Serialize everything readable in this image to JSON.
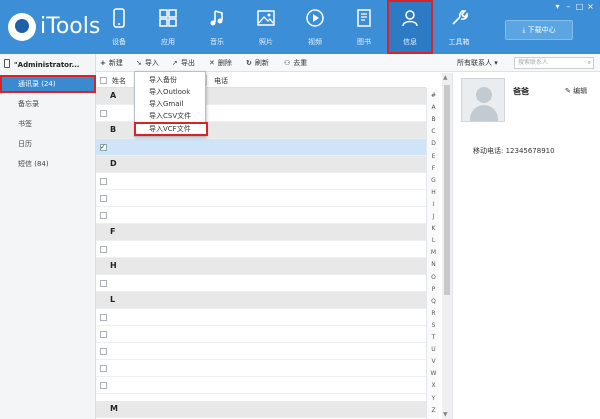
{
  "app": {
    "brand": "iTools"
  },
  "nav": [
    {
      "id": "device",
      "label": "设备",
      "icon": "phone-icon"
    },
    {
      "id": "apps",
      "label": "应用",
      "icon": "apps-grid-icon"
    },
    {
      "id": "music",
      "label": "音乐",
      "icon": "music-note-icon"
    },
    {
      "id": "photos",
      "label": "照片",
      "icon": "picture-icon"
    },
    {
      "id": "video",
      "label": "视频",
      "icon": "play-icon"
    },
    {
      "id": "books",
      "label": "图书",
      "icon": "book-icon"
    },
    {
      "id": "info",
      "label": "信息",
      "icon": "person-icon",
      "active": true
    },
    {
      "id": "tools",
      "label": "工具箱",
      "icon": "wrench-icon"
    }
  ],
  "download_label": "下载中心",
  "device_name": "\"Administrator...",
  "sidebar": {
    "items": [
      {
        "label": "通讯录 (24)",
        "active": true
      },
      {
        "label": "备忘录"
      },
      {
        "label": "书签"
      },
      {
        "label": "日历"
      },
      {
        "label": "短信 (84)"
      }
    ]
  },
  "toolbar": {
    "new": "新建",
    "import": "导入",
    "export": "导出",
    "delete": "删除",
    "refresh": "刷新",
    "dedupe": "去重",
    "filter": "所有联系人",
    "search_placeholder": "搜索联系人"
  },
  "list": {
    "col_name": "姓名",
    "col_phone": "电话",
    "rows": [
      {
        "type": "group",
        "letter": "A"
      },
      {
        "type": "item"
      },
      {
        "type": "group",
        "letter": "B"
      },
      {
        "type": "item",
        "selected": true
      },
      {
        "type": "group",
        "letter": "D"
      },
      {
        "type": "item"
      },
      {
        "type": "item"
      },
      {
        "type": "item"
      },
      {
        "type": "group",
        "letter": "F"
      },
      {
        "type": "item"
      },
      {
        "type": "group",
        "letter": "H"
      },
      {
        "type": "item"
      },
      {
        "type": "group",
        "letter": "L"
      },
      {
        "type": "item"
      },
      {
        "type": "item"
      },
      {
        "type": "item"
      },
      {
        "type": "item"
      },
      {
        "type": "item"
      },
      {
        "type": "group",
        "letter": "M"
      }
    ]
  },
  "alphabet": [
    "#",
    "A",
    "B",
    "C",
    "D",
    "E",
    "F",
    "G",
    "H",
    "I",
    "J",
    "K",
    "L",
    "M",
    "N",
    "O",
    "P",
    "Q",
    "R",
    "S",
    "T",
    "U",
    "V",
    "W",
    "X",
    "Y",
    "Z"
  ],
  "dropdown": {
    "items": [
      {
        "label": "导入备份"
      },
      {
        "label": "导入Outlook"
      },
      {
        "label": "导入Gmail"
      },
      {
        "label": "导入CSV文件"
      },
      {
        "label": "导入VCF文件",
        "highlighted": true
      }
    ]
  },
  "detail": {
    "name": "爸爸",
    "edit_label": "编辑",
    "phone_line": "移动电话: 12345678910"
  },
  "colors": {
    "header": "#3c8ed6",
    "highlight": "#d6242a",
    "selected_row": "#cfe4f7"
  }
}
